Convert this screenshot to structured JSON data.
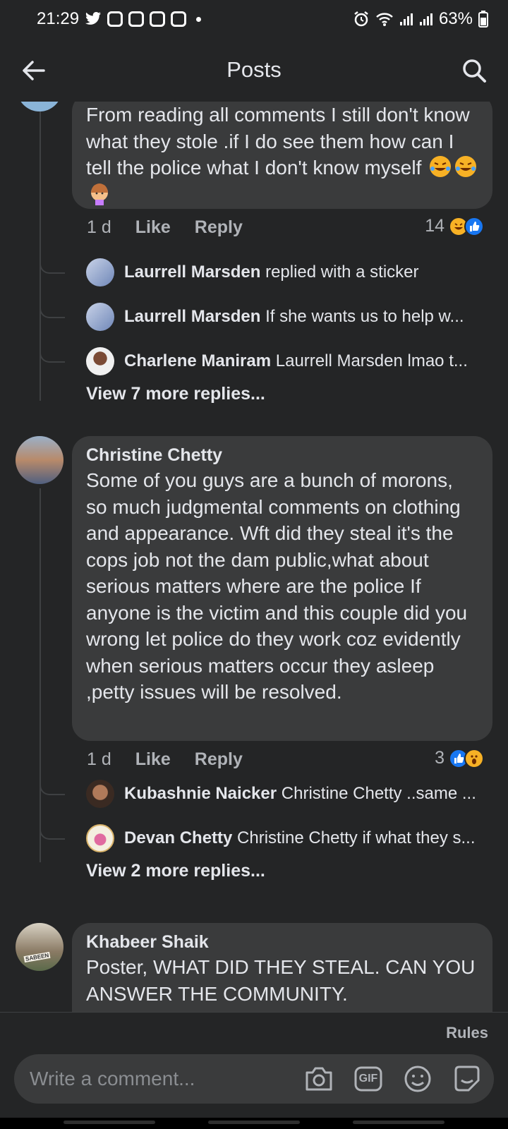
{
  "status_bar": {
    "time": "21:29",
    "battery": "63%",
    "icons": [
      "twitter-icon",
      "notification-icon",
      "notification-icon",
      "notification-icon",
      "notification-icon",
      "alarm-icon",
      "wifi-icon",
      "signal-icon",
      "signal-icon",
      "battery-icon"
    ]
  },
  "header": {
    "title": "Posts"
  },
  "comments": [
    {
      "text": "From reading all comments I still don't know what they stole .if I do see them how can I tell the police what I don't know myself",
      "emojis": [
        "rolling-laughing-emoji",
        "rolling-laughing-emoji",
        "facepalm-emoji"
      ],
      "time": "1 d",
      "like_label": "Like",
      "reply_label": "Reply",
      "reaction_count": "14",
      "replies": [
        {
          "name": "Laurrell Marsden",
          "text": "replied with a sticker"
        },
        {
          "name": "Laurrell Marsden",
          "text": "If she wants us to help w..."
        },
        {
          "name": "Charlene Maniram",
          "text": "Laurrell Marsden lmao t..."
        }
      ],
      "view_more": "View 7 more replies..."
    },
    {
      "author": "Christine Chetty",
      "text": "Some of you guys are a bunch of morons, so much judgmental comments on clothing and appearance. Wft did they steal it's the cops job not the dam public,what about serious matters where are the police  If anyone is the victim and this couple did you wrong let police do they work coz evidently when serious matters occur they asleep ,petty issues will be resolved.",
      "time": "1 d",
      "like_label": "Like",
      "reply_label": "Reply",
      "reaction_count": "3",
      "replies": [
        {
          "name": "Kubashnie Naicker",
          "text": "Christine Chetty ..same ..."
        },
        {
          "name": "Devan Chetty",
          "text": "Christine Chetty if what they s..."
        }
      ],
      "view_more": "View 2 more replies..."
    },
    {
      "author": "Khabeer Shaik",
      "text": "Poster, WHAT DID THEY STEAL. CAN YOU ANSWER THE COMMUNITY.",
      "avatar_caption": "SABEEN"
    }
  ],
  "composer": {
    "rules_label": "Rules",
    "placeholder": "Write a comment...",
    "gif_label": "GIF"
  },
  "colors": {
    "background": "#242526",
    "bubble": "#3a3b3c",
    "text": "#e4e6eb",
    "muted": "#b0b3b8",
    "like_blue": "#1877f2",
    "emoji_yellow": "#f7b125"
  }
}
